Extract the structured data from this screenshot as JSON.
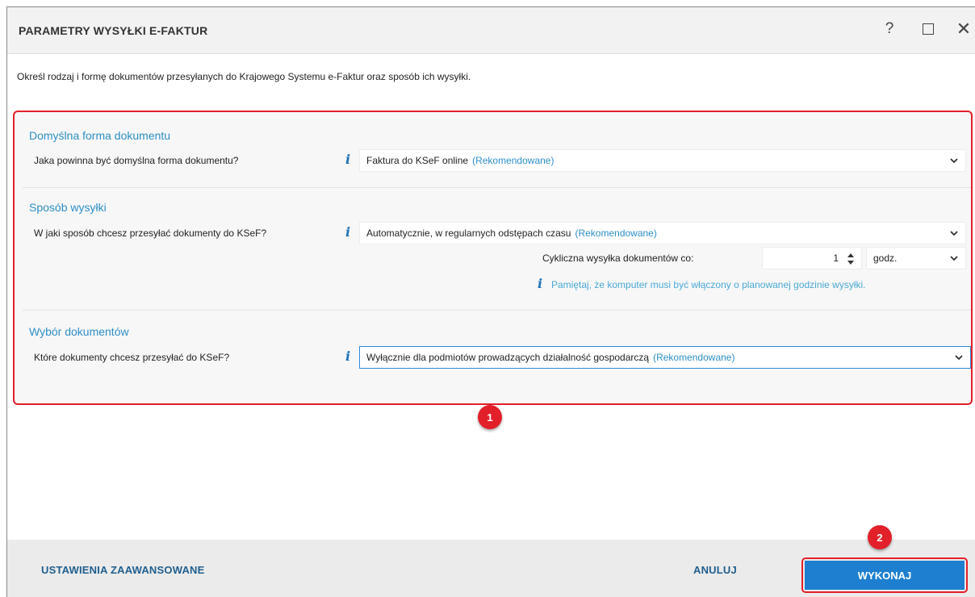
{
  "window": {
    "title": "PARAMETRY WYSYŁKI E-FAKTUR",
    "help_glyph": "?",
    "close_glyph": "✕"
  },
  "description": "Określ rodzaj i formę dokumentów przesyłanych do Krajowego Systemu e-Faktur oraz sposób ich wysyłki.",
  "sections": {
    "form": {
      "title": "Domyślna forma dokumentu",
      "label": "Jaka powinna być domyślna forma dokumentu?",
      "value": "Faktura do KSeF online",
      "tag": "(Rekomendowane)"
    },
    "send": {
      "title": "Sposób wysyłki",
      "label": "W jaki sposób chcesz przesyłać dokumenty do KSeF?",
      "value": "Automatycznie, w regularnych odstępach czasu",
      "tag": "(Rekomendowane)",
      "cycle_label": "Cykliczna wysyłka dokumentów co:",
      "cycle_value": "1",
      "cycle_unit": "godz.",
      "hint": "Pamiętaj, że komputer musi być włączony o planowanej godzinie wysyłki."
    },
    "docs": {
      "title": "Wybór dokumentów",
      "label": "Które dokumenty chcesz przesyłać do KSeF?",
      "value": "Wyłącznie dla podmiotów prowadzących działalność gospodarczą",
      "tag": "(Rekomendowane)"
    }
  },
  "info_glyph": "i",
  "badges": {
    "one": "1",
    "two": "2"
  },
  "footer": {
    "advanced": "USTAWIENIA ZAAWANSOWANE",
    "cancel": "ANULUJ",
    "execute": "WYKONAJ"
  },
  "colors": {
    "accent": "#2d8fc7",
    "primary_button": "#1e7fd0",
    "highlight": "#e2202a"
  }
}
